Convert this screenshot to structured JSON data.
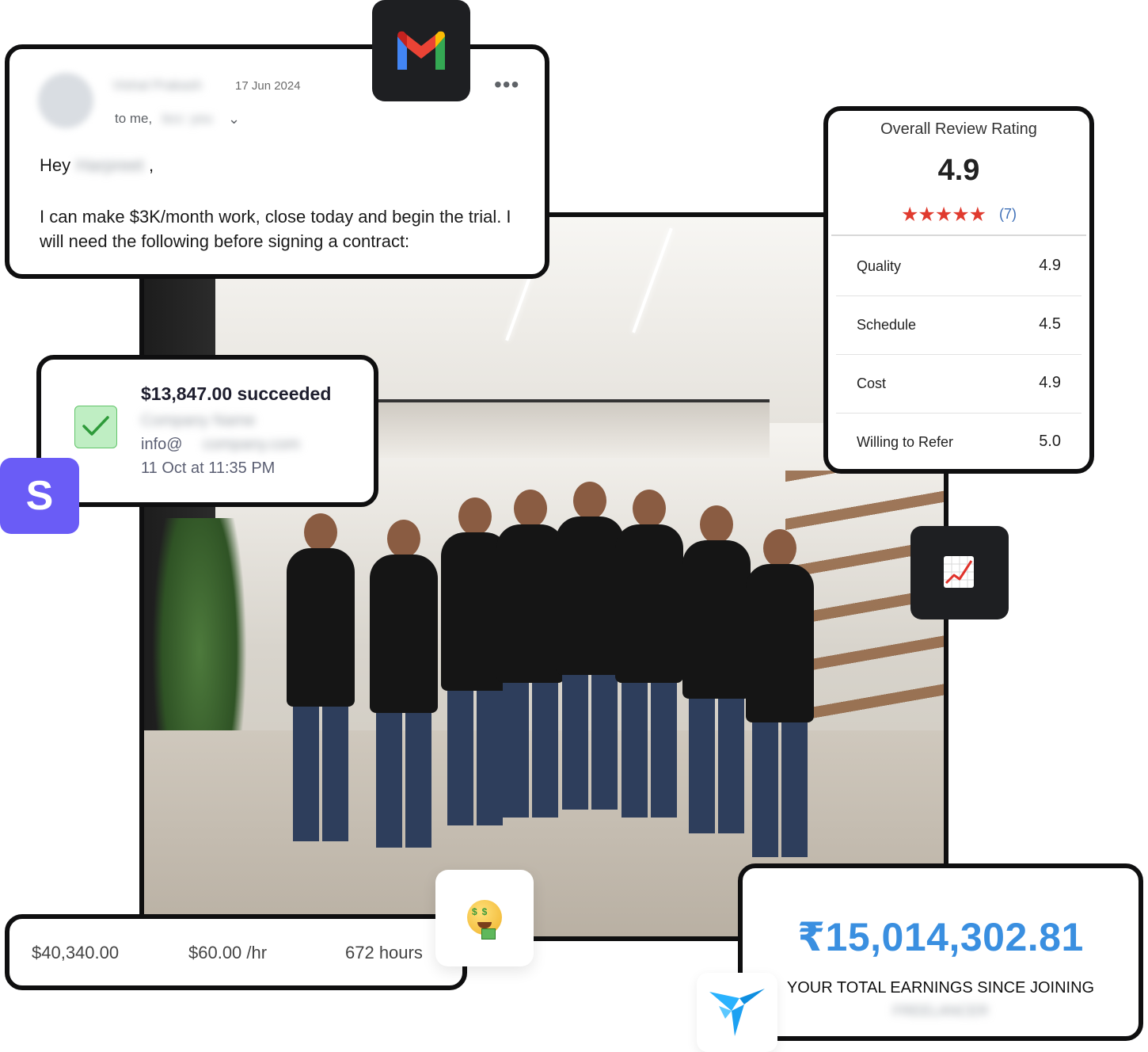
{
  "email": {
    "sender": "Vishal Prakash",
    "date": "17 Jun 2024",
    "to_prefix": "to me,",
    "to_rest": "bcc: you",
    "greeting": "Hey",
    "recipient_name": "Harpreet",
    "greeting_comma": ",",
    "body": "I can make $3K/month work, close today and begin the trial. I will need the following before signing a contract:",
    "app_icon": "gmail-icon"
  },
  "payment": {
    "amount": "$13,847.00 succeeded",
    "company": "Company Name",
    "email_prefix": "info@",
    "email_domain": "company.com",
    "timestamp": "11 Oct at 11:35 PM",
    "app_icon": "stripe-icon",
    "app_letter": "S"
  },
  "review": {
    "title": "Overall Review Rating",
    "score": "4.9",
    "stars": "★★★★★",
    "count": "(7)",
    "rows": [
      {
        "label": "Quality",
        "value": "4.9"
      },
      {
        "label": "Schedule",
        "value": "4.5"
      },
      {
        "label": "Cost",
        "value": "4.9"
      },
      {
        "label": "Willing to Refer",
        "value": "5.0"
      }
    ]
  },
  "stats": {
    "total": "$40,340.00",
    "rate": "$60.00 /hr",
    "hours": "672 hours"
  },
  "earnings": {
    "amount": "₹15,014,302.81",
    "caption": "YOUR TOTAL EARNINGS SINCE JOINING",
    "platform": "FREELANCER"
  },
  "colors": {
    "stripe_purple": "#6a5cf6",
    "earnings_blue": "#3a8fe0",
    "star_red": "#e03a2e",
    "card_border": "#0f0f10"
  }
}
